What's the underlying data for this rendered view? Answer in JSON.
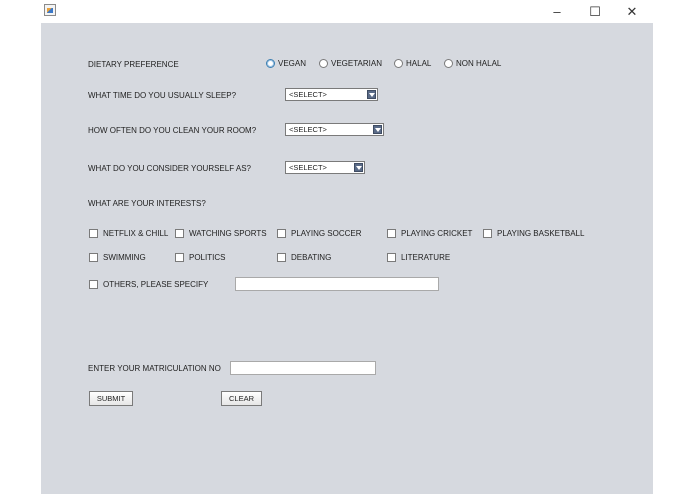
{
  "window": {
    "minimize_glyph": "–",
    "maximize_glyph": "☐",
    "close_glyph": "✕"
  },
  "form": {
    "dietary": {
      "label": "DIETARY PREFERENCE",
      "options": [
        "VEGAN",
        "VEGETARIAN",
        "HALAL",
        "NON HALAL"
      ]
    },
    "sleep": {
      "label": "WHAT TIME DO YOU USUALLY SLEEP?",
      "value": "<SELECT>"
    },
    "clean": {
      "label": "HOW OFTEN DO YOU CLEAN YOUR ROOM?",
      "value": "<SELECT>"
    },
    "consider": {
      "label": "WHAT DO YOU CONSIDER YOURSELF AS?",
      "value": "<SELECT>"
    },
    "interests": {
      "label": "WHAT ARE YOUR INTERESTS?",
      "options": [
        "NETFLIX & CHILL",
        "WATCHING SPORTS",
        "PLAYING SOCCER",
        "PLAYING CRICKET",
        "PLAYING BASKETBALL",
        "SWIMMING",
        "POLITICS",
        "DEBATING",
        "LITERATURE",
        "OTHERS, PLEASE SPECIFY"
      ],
      "others_value": ""
    },
    "matric": {
      "label": "ENTER YOUR MATRICULATION NO",
      "value": ""
    },
    "submit_label": "SUBMIT",
    "clear_label": "CLEAR"
  }
}
